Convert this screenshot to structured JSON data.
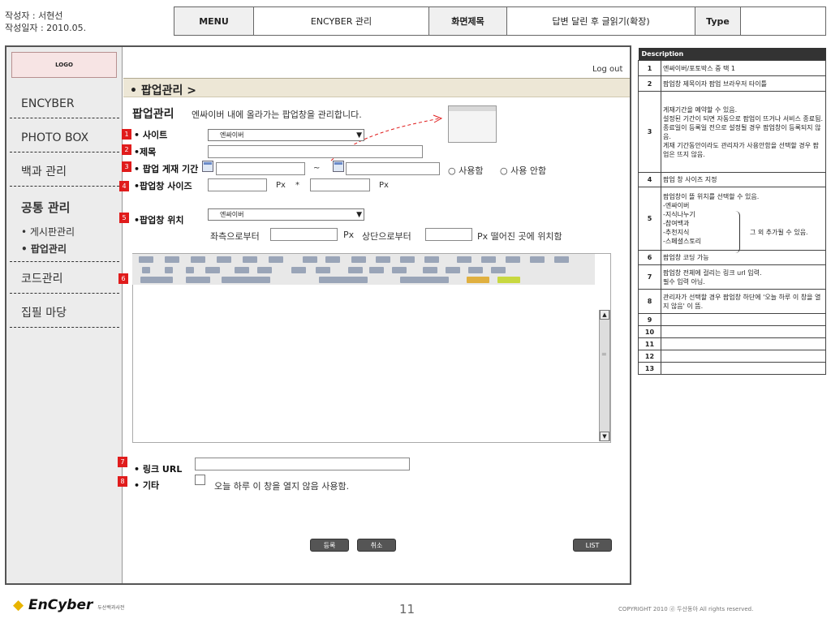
{
  "meta": {
    "author": "작성자 : 서현선",
    "date": "작성일자 : 2010.05."
  },
  "header": {
    "menu_h": "MENU",
    "menu_v": "ENCYBER 관리",
    "screen_h": "화면제목",
    "screen_v": "답변 달린 후 글읽기(확장)",
    "type_h": "Type",
    "type_v": ""
  },
  "sidebar": {
    "logo": "LOGO",
    "items": [
      "ENCYBER",
      "PHOTO BOX",
      "백과 관리",
      "공통 관리",
      "코드관리",
      "집필 마당"
    ],
    "subitems": [
      "• 게시판관리",
      "• 팝업관리"
    ]
  },
  "logout": "Log out",
  "title_bar": "• 팝업관리 >",
  "page": {
    "heading": "팝업관리",
    "description": "엔싸이버 내에 올라가는 팝업창을 관리합니다."
  },
  "nums": [
    "1",
    "2",
    "3",
    "4",
    "5",
    "6",
    "7",
    "8"
  ],
  "form": {
    "site_label": "• 사이트",
    "site_value": "엔싸이버",
    "title_label": "•제목",
    "period_label": "• 팝업 게재 기간",
    "tilde": "~",
    "use_label": "○ 사용함",
    "nouse_label": "○ 사용 안함",
    "size_label": "•팝업창 사이즈",
    "px": "Px",
    "star": "*",
    "pos_label": "•팝업창 위치",
    "pos_value": "엔싸이버",
    "from_left": "좌측으로부터",
    "from_top": "상단으로부터",
    "pos_suffix": "Px 떨어진 곳에 위치함",
    "link_label": "• 링크 URL",
    "etc_label": "• 기타",
    "etc_text": "오늘 하루 이 창을 열지 않음 사용함."
  },
  "buttons": {
    "register": "등록",
    "cancel": "취소",
    "list": "LIST"
  },
  "description": {
    "header": "Description",
    "rows": [
      {
        "n": "1",
        "t": "엔싸이버/포토박스 중 택 1"
      },
      {
        "n": "2",
        "t": "팝업창 제목이자 팝업 브라우저 타이틀"
      },
      {
        "n": "3",
        "t": "게재기간을 예약할 수 있음.\n설정된 기간이 되면 자동으로 팝업이 뜨거나 서비스 종료됨.\n종료일이 등록일 전으로 설정될 경우 팝업창이 등록되지 않음.\n게재 기간동안이라도 관리자가 사용안함을 선택할 경우 팝업은 뜨지 않음."
      },
      {
        "n": "4",
        "t": "팝업 창 사이즈 지정"
      },
      {
        "n": "5",
        "t": "팝업창이 뜰 위치를 선택할 수 있음.\n-엔싸이버\n-지식나누기\n-참여백과\n-추천지식\n-스페셜스토리"
      },
      {
        "n": "6",
        "t": "팝업창 코딩 가능"
      },
      {
        "n": "7",
        "t": "팝업창 전체에 걸리는 링크 url 입력.\n필수 입력 아님."
      },
      {
        "n": "8",
        "t": "관리자가 선택할 경우 팝업창 하단에 '오늘 하루 이 창을 열지 않음' 이 뜸."
      },
      {
        "n": "9",
        "t": ""
      },
      {
        "n": "10",
        "t": ""
      },
      {
        "n": "11",
        "t": ""
      },
      {
        "n": "12",
        "t": ""
      },
      {
        "n": "13",
        "t": ""
      }
    ],
    "extra": "그 외 추가될 수 있음."
  },
  "footer": {
    "brand": "EnCyber",
    "brand_sub": "두산백과사전",
    "page": "11",
    "copyright": "COPYRIGHT 2010 ⓓ 두산동아 All rights reserved."
  }
}
